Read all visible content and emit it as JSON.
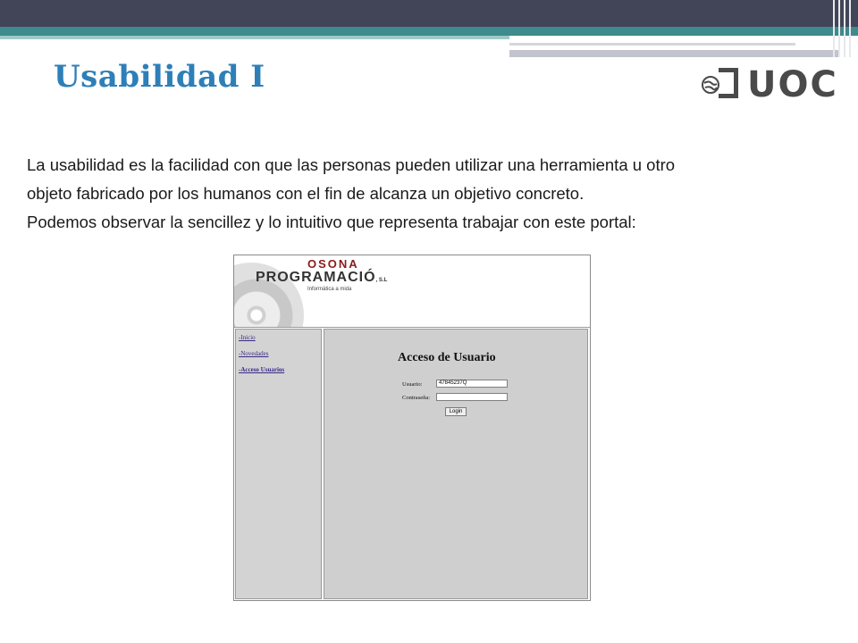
{
  "slide": {
    "title": "Usabilidad I",
    "logo_text": "UOC",
    "paragraphs": [
      "La usabilidad es la facilidad con que las  personas pueden utilizar una herramienta u otro",
      "objeto fabricado por los humanos con el fin de alcanza un objetivo concreto.",
      "Podemos observar la sencillez y lo intuitivo que representa trabajar con este portal:"
    ]
  },
  "embedded_portal": {
    "brand_line1": "OSONA",
    "brand_line2": "PROGRAMACIÓ",
    "brand_suffix": ", S.L",
    "brand_tagline": "Informàtica a mida",
    "sidebar_items": [
      {
        "label": "-Inicio"
      },
      {
        "label": "-Novedades"
      },
      {
        "label": "-Acceso Usuarios"
      }
    ],
    "login": {
      "title": "Acceso de Usuario",
      "user_label": "Usuario:",
      "user_value": "47845237Q",
      "password_label": "Contraseña:",
      "password_value": "",
      "button_label": "Login"
    }
  },
  "colors": {
    "title": "#2e7fb8",
    "top_bar": "#424458",
    "teal_bar": "#3e8a8c",
    "brand_red": "#8b1a1a"
  }
}
